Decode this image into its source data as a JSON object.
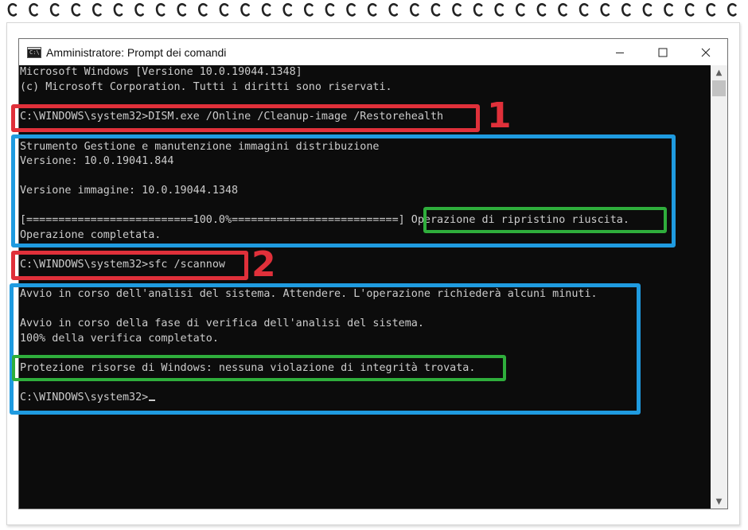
{
  "window": {
    "title": "Amministratore: Prompt dei comandi",
    "icon": "cmd-icon",
    "controls": [
      "minimize-icon",
      "maximize-icon",
      "close-icon"
    ]
  },
  "console": {
    "lines": [
      "Microsoft Windows [Versione 10.0.19044.1348]",
      "(c) Microsoft Corporation. Tutti i diritti sono riservati.",
      "",
      "C:\\WINDOWS\\system32>DISM.exe /Online /Cleanup-image /Restorehealth",
      "",
      "Strumento Gestione e manutenzione immagini distribuzione",
      "Versione: 10.0.19041.844",
      "",
      "Versione immagine: 10.0.19044.1348",
      "",
      "[==========================100.0%==========================] Operazione di ripristino riuscita.",
      "Operazione completata.",
      "",
      "C:\\WINDOWS\\system32>sfc /scannow",
      "",
      "Avvio in corso dell'analisi del sistema. Attendere. L'operazione richiederà alcuni minuti.",
      "",
      "Avvio in corso della fase di verifica dell'analisi del sistema.",
      "100% della verifica completato.",
      "",
      "Protezione risorse di Windows: nessuna violazione di integrità trovata.",
      "",
      "C:\\WINDOWS\\system32>"
    ]
  },
  "annotations": {
    "step1": "1",
    "step2": "2",
    "colors": {
      "command": "#e0303a",
      "output": "#1f9be0",
      "result": "#2fae3c"
    }
  }
}
